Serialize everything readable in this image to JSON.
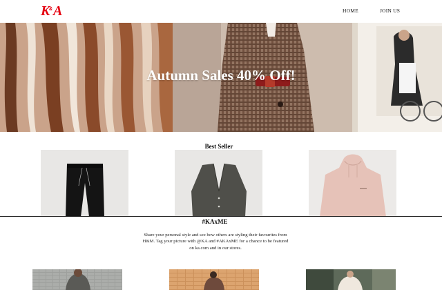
{
  "header": {
    "logo_text": "K&A",
    "nav": [
      {
        "label": "HOME"
      },
      {
        "label": "JOIN US"
      }
    ]
  },
  "hero": {
    "title": "Autumn Sales 40% Off!"
  },
  "best_seller": {
    "title": "Best Seller",
    "products": [
      {
        "icon": "black-joggers-image"
      },
      {
        "icon": "grey-cardigan-image"
      },
      {
        "icon": "pink-hoodie-image"
      }
    ]
  },
  "community": {
    "title": "#KAxME",
    "text": "Share your personal style and see how others are styling their favourites from H&M. Tag your picture with @KA and #AKAxME for a chance to be featured on ka.com and in our stores."
  },
  "colors": {
    "brand_red": "#e50010",
    "divider": "#2a2a2a"
  }
}
